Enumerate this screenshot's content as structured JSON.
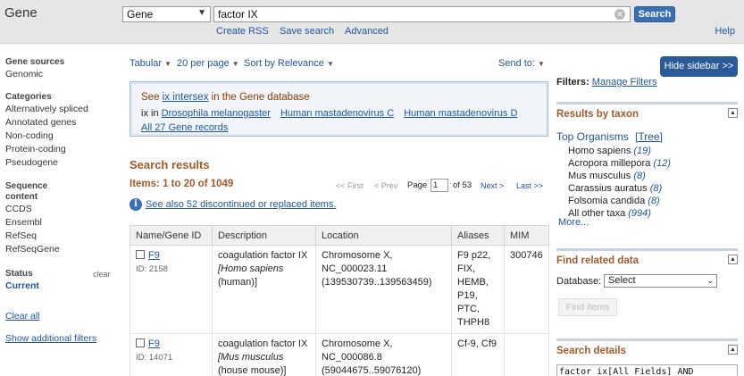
{
  "header": {
    "app_title": "Gene",
    "db_select": "Gene",
    "search_value": "factor IX",
    "search_button": "Search",
    "links": [
      "Create RSS",
      "Save search",
      "Advanced"
    ],
    "help": "Help"
  },
  "left_sidebar": {
    "gene_sources": {
      "title": "Gene sources",
      "items": [
        "Genomic"
      ]
    },
    "categories": {
      "title": "Categories",
      "items": [
        "Alternatively spliced",
        "Annotated genes",
        "Non-coding",
        "Protein-coding",
        "Pseudogene"
      ]
    },
    "sequence_content": {
      "title_line1": "Sequence",
      "title_line2": "content",
      "items": [
        "CCDS",
        "Ensembl",
        "RefSeq",
        "RefSeqGene"
      ]
    },
    "status": {
      "title": "Status",
      "clear": "clear",
      "items": [
        "Current"
      ]
    },
    "clear_all": "Clear all",
    "show_additional": "Show additional filters"
  },
  "toolbar": {
    "format": "Tabular",
    "per_page": "20 per page",
    "sort": "Sort by Relevance",
    "send_to": "Send to:"
  },
  "see_box": {
    "line1_prefix": "See ",
    "line1_link": "ix intersex",
    "line1_suffix": " in the Gene database",
    "line2_prefix": "ix in ",
    "organism_links": [
      "Drosophila melanogaster",
      "Human mastadenovirus C",
      "Human mastadenovirus D",
      "All 27 Gene records"
    ]
  },
  "results": {
    "title": "Search results",
    "items_count": "Items: 1 to 20 of 1049",
    "pager": {
      "first": "<< First",
      "prev": "< Prev",
      "page_label": "Page",
      "page_value": "1",
      "of_pages": "of 53",
      "next": "Next >",
      "last": "Last >>"
    },
    "see_also": "See also 52 discontinued or replaced items.",
    "columns": [
      "Name/Gene ID",
      "Description",
      "Location",
      "Aliases",
      "MIM"
    ],
    "rows": [
      {
        "name": "F9",
        "gene_id": "ID: 2158",
        "desc_main": "coagulation factor IX",
        "desc_species": "[Homo sapiens",
        "desc_common": "(human)]",
        "loc_chr": "Chromosome X,",
        "loc_acc": "NC_000023.11",
        "loc_range": "(139530739..139563459)",
        "aliases": [
          "F9 p22,",
          "FIX,",
          "HEMB,",
          "P19,",
          "PTC,",
          "THPH8"
        ],
        "mim": "300746"
      },
      {
        "name": "F9",
        "gene_id": "ID: 14071",
        "desc_main": "coagulation factor IX",
        "desc_species": "[Mus musculus",
        "desc_common": "(house mouse)]",
        "loc_chr": "Chromosome X,",
        "loc_acc": "NC_000086.8",
        "loc_range": "(59044675..59076120)",
        "aliases": [
          "Cf-9, Cf9"
        ],
        "mim": ""
      }
    ]
  },
  "right_sidebar": {
    "hide_sidebar": "Hide sidebar >>",
    "filters_label": "Filters:",
    "manage_filters": "Manage Filters",
    "taxon": {
      "title": "Results by taxon",
      "top_organisms": "Top Organisms",
      "tree": "[Tree]",
      "items": [
        {
          "name": "Homo sapiens",
          "count": "(19)"
        },
        {
          "name": "Acropora millepora",
          "count": "(12)"
        },
        {
          "name": "Mus musculus",
          "count": "(8)"
        },
        {
          "name": "Carassius auratus",
          "count": "(8)"
        },
        {
          "name": "Folsomia candida",
          "count": "(8)"
        },
        {
          "name": "All other taxa",
          "count": "(994)"
        }
      ],
      "more": "More..."
    },
    "related": {
      "title": "Find related data",
      "db_label": "Database:",
      "db_value": "Select",
      "find_button": "Find items"
    },
    "details": {
      "title": "Search details",
      "query": "factor ix[All Fields] AND"
    }
  }
}
